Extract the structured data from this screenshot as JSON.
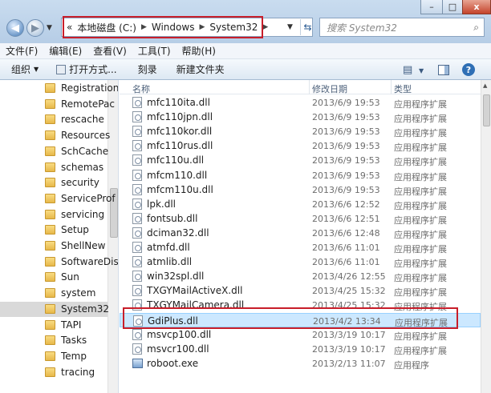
{
  "window": {
    "address": [
      "本地磁盘 (C:)",
      "Windows",
      "System32"
    ],
    "search_placeholder": "搜索 System32",
    "controls": {
      "minimize": "–",
      "maximize": "□",
      "close": "x"
    }
  },
  "menu": [
    "文件(F)",
    "编辑(E)",
    "查看(V)",
    "工具(T)",
    "帮助(H)"
  ],
  "toolbar": {
    "organize": "组织",
    "open_with": "打开方式...",
    "burn": "刻录",
    "new_folder": "新建文件夹",
    "help_glyph": "?"
  },
  "nav": [
    "Registration",
    "RemotePac",
    "rescache",
    "Resources",
    "SchCache",
    "schemas",
    "security",
    "ServiceProf",
    "servicing",
    "Setup",
    "ShellNew",
    "SoftwareDis",
    "Sun",
    "system",
    "System32",
    "TAPI",
    "Tasks",
    "Temp",
    "tracing"
  ],
  "nav_selected": "System32",
  "columns": {
    "name": "名称",
    "date": "修改日期",
    "type": "类型"
  },
  "files": [
    {
      "name": "mfc110ita.dll",
      "date": "2013/6/9 19:53",
      "type": "应用程序扩展",
      "icon": "dll"
    },
    {
      "name": "mfc110jpn.dll",
      "date": "2013/6/9 19:53",
      "type": "应用程序扩展",
      "icon": "dll"
    },
    {
      "name": "mfc110kor.dll",
      "date": "2013/6/9 19:53",
      "type": "应用程序扩展",
      "icon": "dll"
    },
    {
      "name": "mfc110rus.dll",
      "date": "2013/6/9 19:53",
      "type": "应用程序扩展",
      "icon": "dll"
    },
    {
      "name": "mfc110u.dll",
      "date": "2013/6/9 19:53",
      "type": "应用程序扩展",
      "icon": "dll"
    },
    {
      "name": "mfcm110.dll",
      "date": "2013/6/9 19:53",
      "type": "应用程序扩展",
      "icon": "dll"
    },
    {
      "name": "mfcm110u.dll",
      "date": "2013/6/9 19:53",
      "type": "应用程序扩展",
      "icon": "dll"
    },
    {
      "name": "lpk.dll",
      "date": "2013/6/6 12:52",
      "type": "应用程序扩展",
      "icon": "dll"
    },
    {
      "name": "fontsub.dll",
      "date": "2013/6/6 12:51",
      "type": "应用程序扩展",
      "icon": "dll"
    },
    {
      "name": "dciman32.dll",
      "date": "2013/6/6 12:48",
      "type": "应用程序扩展",
      "icon": "dll"
    },
    {
      "name": "atmfd.dll",
      "date": "2013/6/6 11:01",
      "type": "应用程序扩展",
      "icon": "dll"
    },
    {
      "name": "atmlib.dll",
      "date": "2013/6/6 11:01",
      "type": "应用程序扩展",
      "icon": "dll"
    },
    {
      "name": "win32spl.dll",
      "date": "2013/4/26 12:55",
      "type": "应用程序扩展",
      "icon": "dll"
    },
    {
      "name": "TXGYMailActiveX.dll",
      "date": "2013/4/25 15:32",
      "type": "应用程序扩展",
      "icon": "dll"
    },
    {
      "name": "TXGYMailCamera.dll",
      "date": "2013/4/25 15:32",
      "type": "应用程序扩展",
      "icon": "dll"
    },
    {
      "name": "GdiPlus.dll",
      "date": "2013/4/2 13:34",
      "type": "应用程序扩展",
      "icon": "dll"
    },
    {
      "name": "msvcp100.dll",
      "date": "2013/3/19 10:17",
      "type": "应用程序扩展",
      "icon": "dll"
    },
    {
      "name": "msvcr100.dll",
      "date": "2013/3/19 10:17",
      "type": "应用程序扩展",
      "icon": "dll"
    },
    {
      "name": "roboot.exe",
      "date": "2013/2/13 11:07",
      "type": "应用程序",
      "icon": "exe"
    }
  ],
  "selected_file": "GdiPlus.dll"
}
